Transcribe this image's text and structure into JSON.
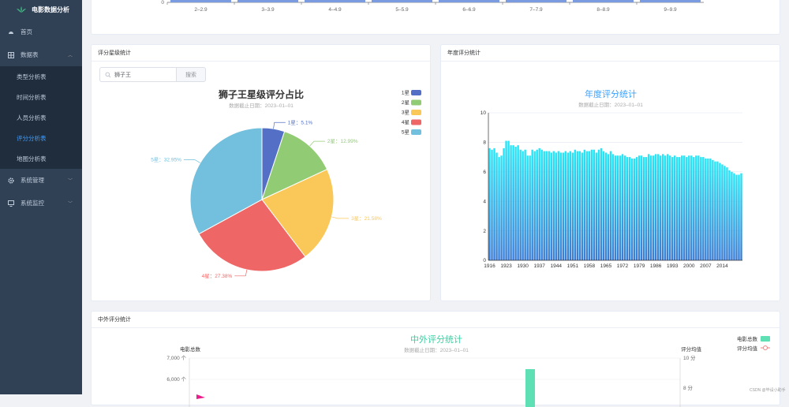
{
  "app": {
    "title": "电影数据分析"
  },
  "sidebar": {
    "items": [
      {
        "label": "首页",
        "icon": "dashboard-icon"
      },
      {
        "label": "数据表",
        "icon": "table-icon",
        "sub": [
          "类型分析表",
          "时间分析表",
          "人员分析表",
          "评分分析表",
          "地图分析表"
        ]
      },
      {
        "label": "系统管理",
        "icon": "gear-icon"
      },
      {
        "label": "系统监控",
        "icon": "monitor-icon"
      }
    ]
  },
  "colors": {
    "sidebar": "#304156",
    "active": "#409eff",
    "s1": "#5470c6",
    "s2": "#91cc75",
    "s3": "#fac858",
    "s4": "#ee6666",
    "s5": "#73c0de",
    "bars": "#3fd7f7",
    "compare": "#5fe0b4"
  },
  "top_card": {
    "tick_labels": [
      "0",
      "2–2.9",
      "3–3.9",
      "4–4.9",
      "5–5.9",
      "6–6.9",
      "7–7.9",
      "8–8.9",
      "9–9.9"
    ]
  },
  "star_card": {
    "header": "评分星级统计",
    "search": {
      "value": "狮子王",
      "button": "搜索"
    },
    "chart_data": {
      "type": "pie",
      "title": "狮子王星级评分占比",
      "subtitle": "数据截止日期：2023–01–01",
      "labels": [
        "1星",
        "2星",
        "3星",
        "4星",
        "5星"
      ],
      "values": [
        5.1,
        12.99,
        21.58,
        27.38,
        32.95
      ],
      "slice_labels": [
        "1星：5.1%",
        "2星：12.99%",
        "3星：21.58%",
        "4星：27.38%",
        "5星：32.95%"
      ],
      "legend": "top-right"
    }
  },
  "year_card": {
    "header": "年度评分统计",
    "chart_data": {
      "type": "bar",
      "title": "年度评分统计",
      "subtitle": "数据截止日期：2023–01–01",
      "x_start": 1916,
      "x_end": 2022,
      "x_ticks": [
        "1916",
        "1923",
        "1930",
        "1937",
        "1944",
        "1951",
        "1958",
        "1965",
        "1972",
        "1979",
        "1986",
        "1993",
        "2000",
        "2007",
        "2014"
      ],
      "y_ticks": [
        "0",
        "2",
        "4",
        "6",
        "8",
        "10"
      ],
      "ylim": [
        0,
        10
      ],
      "values": [
        7.6,
        7.5,
        7.6,
        7.3,
        7,
        7.1,
        7.6,
        8.1,
        8.1,
        7.8,
        7.8,
        7.7,
        7.8,
        7.5,
        7.4,
        7.5,
        7.1,
        7.1,
        7.5,
        7.4,
        7.5,
        7.6,
        7.5,
        7.4,
        7.4,
        7.4,
        7.3,
        7.4,
        7.3,
        7.4,
        7.3,
        7.3,
        7.4,
        7.3,
        7.4,
        7.3,
        7.5,
        7.4,
        7.4,
        7.3,
        7.5,
        7.4,
        7.4,
        7.5,
        7.5,
        7.3,
        7.5,
        7.6,
        7.4,
        7.3,
        7.2,
        7.4,
        7.2,
        7.1,
        7.1,
        7.1,
        7.2,
        7.1,
        7,
        7,
        6.9,
        6.9,
        7,
        7.1,
        7.1,
        7,
        7,
        7.2,
        7.1,
        7.1,
        7.2,
        7.2,
        7.1,
        7.2,
        7.1,
        7.2,
        7.1,
        7,
        7.1,
        7,
        7,
        7.1,
        7.1,
        7,
        7.1,
        7.1,
        7,
        7.1,
        7.1,
        7,
        7,
        6.9,
        6.9,
        6.9,
        6.8,
        6.7,
        6.7,
        6.6,
        6.5,
        6.4,
        6.3,
        6.1,
        6,
        5.9,
        5.8,
        5.8,
        5.9
      ]
    }
  },
  "compare_card": {
    "header": "中外评分统计",
    "chart_data": {
      "type": "bar",
      "title": "中外评分统计",
      "subtitle": "数据截止日期：2023–01–01",
      "ylabel_left": "电影总数",
      "ylabel_right": "评分均值",
      "left_ticks": [
        "7,000 个",
        "6,000 个"
      ],
      "right_ticks": [
        "10 分",
        "8 分"
      ],
      "legend": [
        "电影总数",
        "评分均值"
      ]
    }
  },
  "watermark": "CSDN @毕设小助手"
}
